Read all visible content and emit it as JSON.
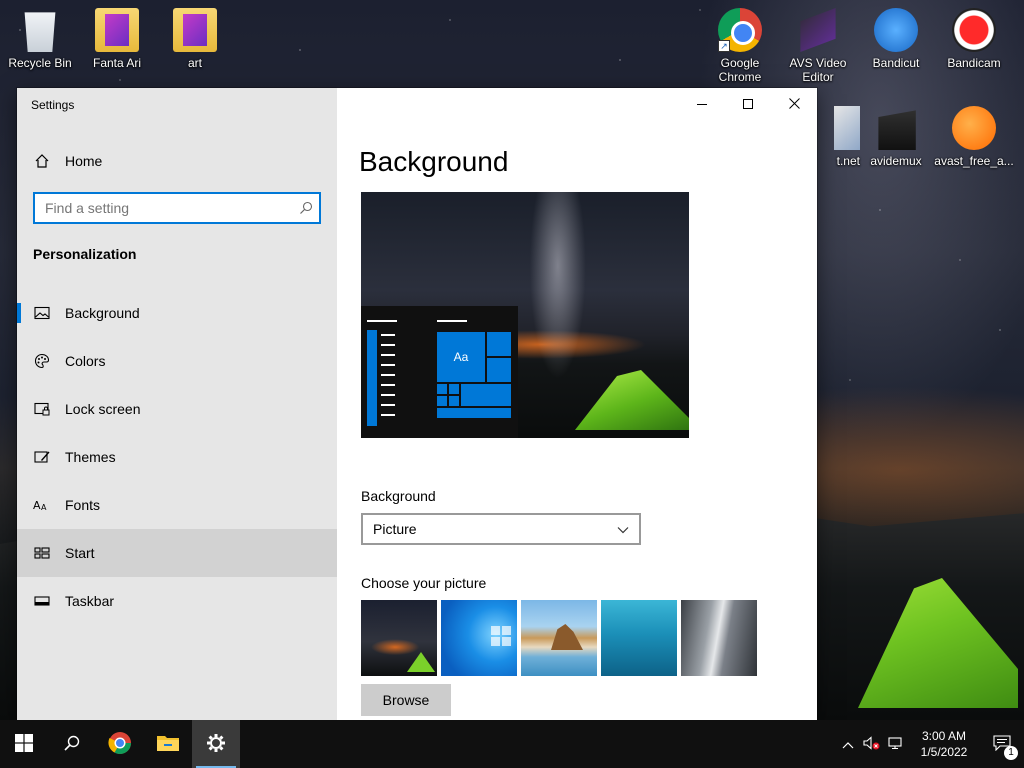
{
  "desktop": {
    "icons": [
      {
        "label": "Recycle Bin"
      },
      {
        "label": "Fanta Ari"
      },
      {
        "label": "art"
      },
      {
        "label": "Google Chrome"
      },
      {
        "label": "AVS Video Editor"
      },
      {
        "label": "Bandicut"
      },
      {
        "label": "Bandicam"
      },
      {
        "label": "t.net"
      },
      {
        "label": "avidemux"
      },
      {
        "label": "avast_free_a..."
      }
    ]
  },
  "window": {
    "title": "Settings",
    "controls": {
      "minimize": "minimize-icon",
      "maximize": "maximize-icon",
      "close": "close-icon"
    }
  },
  "sidebar": {
    "home_label": "Home",
    "search_placeholder": "Find a setting",
    "section_title": "Personalization",
    "items": [
      {
        "label": "Background",
        "icon": "picture-icon",
        "active": true
      },
      {
        "label": "Colors",
        "icon": "palette-icon"
      },
      {
        "label": "Lock screen",
        "icon": "lock-screen-icon"
      },
      {
        "label": "Themes",
        "icon": "themes-icon"
      },
      {
        "label": "Fonts",
        "icon": "fonts-icon"
      },
      {
        "label": "Start",
        "icon": "start-icon",
        "hover": true
      },
      {
        "label": "Taskbar",
        "icon": "taskbar-icon"
      }
    ]
  },
  "main": {
    "title": "Background",
    "preview": {
      "tile_label": "Aa"
    },
    "background_label": "Background",
    "background_value": "Picture",
    "choose_label": "Choose your picture",
    "browse_label": "Browse"
  },
  "taskbar": {
    "clock_time": "3:00 AM",
    "clock_date": "1/5/2022",
    "notification_count": "1",
    "accent": "#0078d7"
  }
}
